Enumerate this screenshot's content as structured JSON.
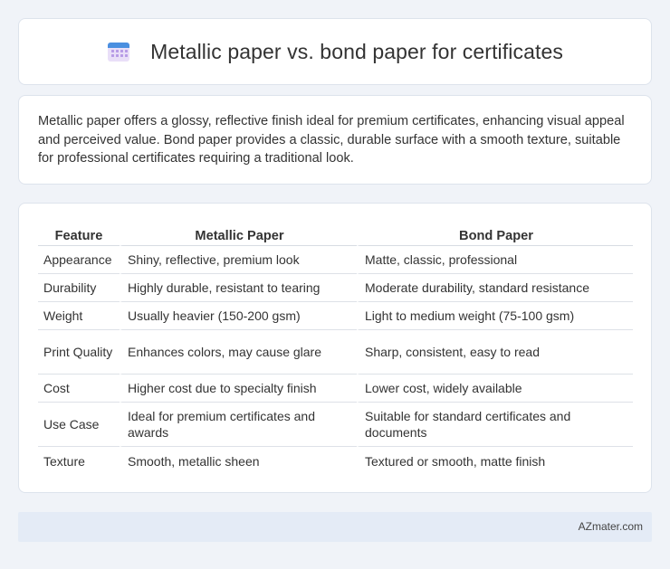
{
  "header": {
    "icon": "calendar-icon",
    "title": "Metallic paper vs. bond paper for certificates"
  },
  "intro": {
    "text": "Metallic paper offers a glossy, reflective finish ideal for premium certificates, enhancing visual appeal and perceived value. Bond paper provides a classic, durable surface with a smooth texture, suitable for professional certificates requiring a traditional look."
  },
  "table": {
    "headers": [
      "Feature",
      "Metallic Paper",
      "Bond Paper"
    ],
    "rows": [
      [
        "Appearance",
        "Shiny, reflective, premium look",
        "Matte, classic, professional"
      ],
      [
        "Durability",
        "Highly durable, resistant to tearing",
        "Moderate durability, standard resistance"
      ],
      [
        "Weight",
        "Usually heavier (150-200 gsm)",
        "Light to medium weight (75-100 gsm)"
      ],
      [
        "Print Quality",
        "Enhances colors, may cause glare",
        "Sharp, consistent, easy to read"
      ],
      [
        "Cost",
        "Higher cost due to specialty finish",
        "Lower cost, widely available"
      ],
      [
        "Use Case",
        "Ideal for premium certificates and awards",
        "Suitable for standard certificates and documents"
      ],
      [
        "Texture",
        "Smooth, metallic sheen",
        "Textured or smooth, matte finish"
      ]
    ]
  },
  "footer": {
    "text": "AZmater.com"
  },
  "colors": {
    "background": "#f0f3f8",
    "card": "#ffffff",
    "footer_bg": "#e4ebf6",
    "icon_top": "#4a8fe0",
    "icon_body": "#e9dff8"
  }
}
